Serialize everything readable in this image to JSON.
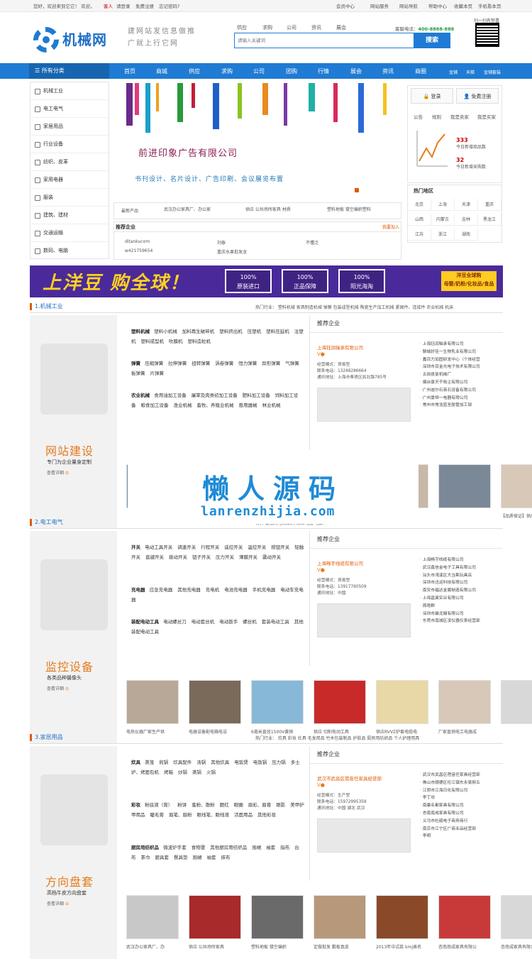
{
  "topbar": {
    "greeting": "您好，欢迎来到它它！ 欢迎，",
    "user": "客人",
    "login": "请登录",
    "register": "免费注册",
    "forgot": "忘记密码?",
    "links": [
      "会员中心",
      "网站服务",
      "网站导航",
      "帮助中心",
      "收藏本页",
      "手机看本页"
    ]
  },
  "header": {
    "logo": "机械网",
    "slogan": "建网站发信息做推广就上行它网",
    "search_tabs": [
      "供应",
      "求购",
      "公司",
      "资讯",
      "展会"
    ],
    "search_placeholder": "请输入关键词",
    "search_button": "搜索",
    "hotline_label": "客服电话：",
    "hotline": "400-8888-888",
    "qr_label": "扫一扫有惊喜"
  },
  "nav": {
    "all": "所有分类",
    "items": [
      "首页",
      "商城",
      "供应",
      "求购",
      "公司",
      "团购",
      "行情",
      "展会",
      "资讯",
      "商圈",
      "金铺",
      "天梯",
      "金铺套装"
    ]
  },
  "sidebar": [
    "机械工业",
    "电工电气",
    "家居用品",
    "行业设备",
    "纺织、皮革",
    "家用电器",
    "服装",
    "建筑、建材",
    "交通运输",
    "数码、电脑"
  ],
  "banner": {
    "title": "前进印象广告有限公司",
    "sub": "书刊设计、名片设计、广告印刷、会议展览布置"
  },
  "new_products": {
    "label": "最新产品",
    "items": [
      "武汉办公家具厂、办公家",
      "供应 公共场所家具 材质",
      "塑料地板 镂空编织塑料"
    ]
  },
  "recommend": {
    "title": "推荐企业",
    "more": "我要加入",
    "items": [
      "ditankucom",
      "刘泰",
      "不懂泛",
      "w421759654",
      "重庆水果批发龙"
    ]
  },
  "login": {
    "login": "登录",
    "register": "免费注册",
    "tabs": [
      "公告",
      "规则",
      "我是卖家",
      "我是买家"
    ],
    "stat1_num": "333",
    "stat1_label": "今日新增商品数",
    "stat2_num": "32",
    "stat2_label": "今日新增采购数"
  },
  "hot": {
    "title": "热门地区",
    "cities": [
      "北京",
      "上海",
      "天津",
      "重庆",
      "山西",
      "内蒙古",
      "吉林",
      "黑龙江",
      "江苏",
      "浙江",
      "湖南"
    ]
  },
  "ad": {
    "headline": "上洋豆 购全球！",
    "pills": [
      "100%\n原装进口",
      "100%\n正品保障",
      "100%\n阳光海淘"
    ],
    "right": "洋豆全球购\n母婴/奶粉/化妆品/食品"
  },
  "sections": [
    {
      "title": "1.机械工业",
      "links": "热门行业： 塑料机械 家具制造机械 弹簧 包装成型机械 陶瓷生产加工机械 紧固件、连接件 农业机械 机床",
      "promo_head": "网站建设",
      "promo_sub": "专门为企业量身定制",
      "promo_more": "查看详细",
      "cats": [
        {
          "h": "塑料机械",
          "items": [
            "塑料小机械",
            "加料再生破碎机",
            "塑料挤出机",
            "压塑机",
            "塑料压延机",
            "注塑机",
            "塑料成型机",
            "吹膜机",
            "塑料造粒机"
          ]
        },
        {
          "h": "弹簧",
          "items": [
            "压缩弹簧",
            "拉伸弹簧",
            "扭转弹簧",
            "涡卷弹簧",
            "恒力弹簧",
            "异形弹簧",
            "气弹簧",
            "板弹簧",
            "片弹簧"
          ]
        },
        {
          "h": "农业机械",
          "items": [
            "食用油加工设备",
            "屠宰及肉类初加工设备",
            "肥料加工设备",
            "饲料加工设备",
            "粮食加工设备",
            "渔业机械",
            "畜牧、养殖业机械",
            "兽用器械",
            "林业机械"
          ]
        }
      ],
      "rec_title": "推荐企业",
      "rec_company": "上海钰润轴承有限公司",
      "rec_info": [
        "经营模式：贸易型",
        "联系电话：13248286664",
        "通讯地址：上海市奉贤区如北路785号"
      ],
      "rec_list": [
        "上海钰润轴承有限公司",
        "聊城好佳一生物乳业有限公司",
        "嘉百力加固研发中心（个体经营",
        "深圳市百金光电子技术有限公司",
        "五田县复机械厂",
        "烟台景天干吸尘有限公司",
        "广州迪尔石英石设备有限公司",
        "广州景恒一电器有限公司",
        "常州市常浩蓝圣胶管加工部"
      ],
      "thumbs": [
        "",
        "",
        "",
        "",
        "",
        "",
        "【品质保证】供应专"
      ]
    },
    {
      "title": "2.电工电气",
      "links": "材料 最抵光电动工具 高压电器 电源",
      "promo_head": "监控设备",
      "promo_sub": "各类品种摄像头",
      "promo_more": "查看详细",
      "cats": [
        {
          "h": "开关",
          "items": [
            "电动工具开关",
            "调速开关",
            "行程开关",
            "遥控开关",
            "温控开关",
            "按钮开关",
            "轻触开关",
            "直键开关",
            "拨动开关",
            "钮子开关",
            "压力开关",
            "薄膜开关",
            "震动开关"
          ]
        },
        {
          "h": "充电器",
          "items": [
            "应急充电器",
            "其他充电器",
            "充电机",
            "电池充电器",
            "手机充电器",
            "电动车充电器"
          ]
        },
        {
          "h": "装配电动工具",
          "items": [
            "电动螺丝刀",
            "电动套丝机",
            "电动扳手",
            "螺丝机",
            "套装电动工具",
            "其他装配电动工具"
          ]
        }
      ],
      "rec_title": "推荐企业",
      "rec_company": "上海畅宇线缆有限公司",
      "rec_info": [
        "经营模式：贸易型",
        "联系电话：13917760509",
        "通讯地址：中国"
      ],
      "rec_list": [
        "上海畅宇线缆有限公司",
        "武汉鑫信金电子工具有限公司",
        "汕头市湾溪区大当斯玩具店",
        "深圳市迅运科技有限公司",
        "南安市福达金属制造有限公司",
        "上海昌寅实业有限公司",
        "周艳群",
        "深圳市晨龙娟有限公司",
        "东莞市南城区凌仪器仪表经营部"
      ],
      "thumbs": [
        "电热仪器厂家生产供",
        "电器设备配电箱电设",
        "6毫米直径1500V黄铜",
        "供应 切削电动工具",
        "供应RVVZ护套电缆电",
        "厂家直销电工电器成",
        ""
      ]
    },
    {
      "title": "3.家居用品",
      "links": "热门行业： 炊具 彩妆 灶具 毛发用品 竹木包装制品 护肤品 厨房用纺织品 个人护理用具",
      "promo_head": "方向盘套",
      "promo_sub": "高档牛皮方向盘套",
      "promo_more": "查看详细",
      "cats": [
        {
          "h": "炊具",
          "items": [
            "蒸笼",
            "煎锅",
            "炊具配件",
            "汤锅",
            "其他炊具",
            "电饭煲",
            "电饭锅",
            "压力锅",
            "多士炉、烤面包机",
            "烤箱",
            "炒锅",
            "蒸锅",
            "火锅"
          ]
        },
        {
          "h": "彩妆",
          "items": [
            "粉底液（膏）",
            "粉饼",
            "蜜粉、散粉",
            "腮红",
            "眼圈",
            "眉彩、眉膏",
            "眼影",
            "美甲护甲用品",
            "睫毛膏",
            "眉笔、眉粉",
            "眼线笔、眼线液",
            "活面用品",
            "其他彩妆"
          ]
        },
        {
          "h": "厨房用纺织品",
          "items": [
            "微波炉手套",
            "食物罩",
            "其他厨房用纺织品",
            "围裙",
            "袖套",
            "指布",
            "台布",
            "茶巾",
            "厨具套",
            "餐具垫",
            "围裙",
            "袖套",
            "抹布"
          ]
        }
      ],
      "rec_title": "推荐企业",
      "rec_company": "武汉市武昌区蓓宙任家具经营部",
      "rec_info": [
        "经营模式：生产型",
        "联系电话：15972995358",
        "通讯地址：中国 湖北 武汉"
      ],
      "rec_list": [
        "武汉市武昌区蓓宙任家具经营部",
        "佛山市顺德区伦江镇东永豪厨五",
        "江阴市江海日化有限公司",
        "李丁欣",
        "南康名都家具有限公司",
        "杏南南成家具有限公司",
        "义乌市杜鹃电子商务商行",
        "南京市江宁区广商业品经营部",
        "李明"
      ],
      "thumbs": [
        "武汉办公家具厂、办",
        "供应 公共场所家具",
        "塑料地板 镂空编织",
        "定做批发 鹏板真皮",
        "2013年中式款 kmj乘名",
        "杏南南成家具有限公",
        "杏南成家具有限公"
      ]
    }
  ],
  "watermark": {
    "cn": "懒人源码",
    "en": "lanrenzhijia.com"
  }
}
